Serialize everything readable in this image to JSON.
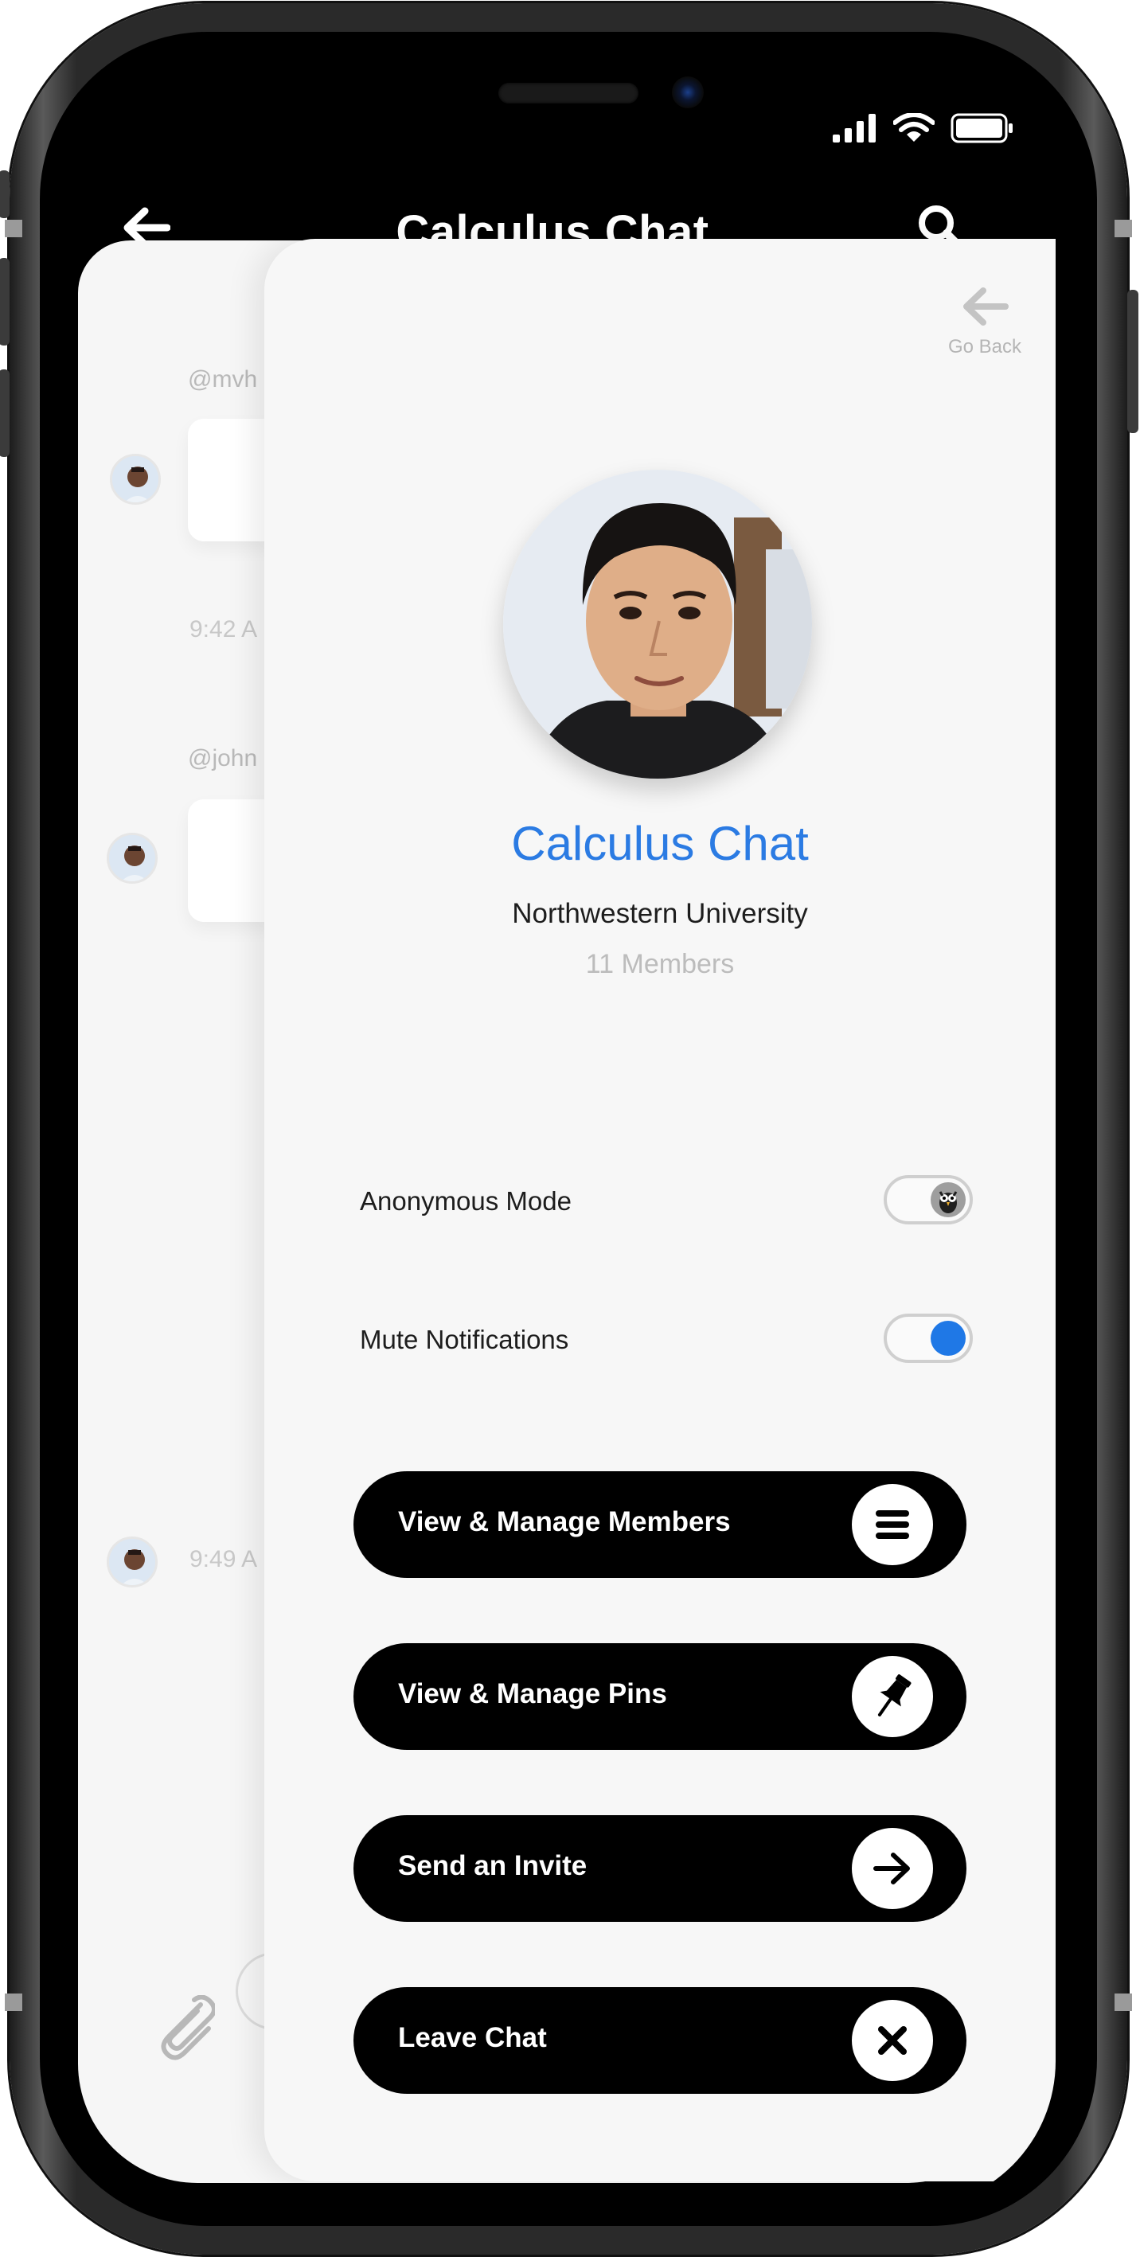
{
  "header": {
    "title": "Calculus Chat",
    "back_icon": "arrow-left-icon",
    "search_icon": "search-icon"
  },
  "status_bar": {
    "icons": [
      "signal-icon",
      "wifi-icon",
      "battery-icon"
    ]
  },
  "chat_background": {
    "messages": [
      {
        "user": "@mvh",
        "time": "9:42 A"
      },
      {
        "user": "@john",
        "time": "9:49 A"
      }
    ],
    "attach_icon": "paperclip-icon"
  },
  "info_panel": {
    "go_back_label": "Go Back",
    "group_name": "Calculus Chat",
    "school": "Northwestern University",
    "members": "11 Members",
    "settings": [
      {
        "label": "Anonymous Mode",
        "enabled": false,
        "icon": "owl-icon"
      },
      {
        "label": "Mute Notifications",
        "enabled": true
      }
    ],
    "actions": [
      {
        "label": "View & Manage Members",
        "icon": "list-icon"
      },
      {
        "label": "View & Manage Pins",
        "icon": "pin-icon"
      },
      {
        "label": "Send an Invite",
        "icon": "arrow-right-icon"
      },
      {
        "label": "Leave Chat",
        "icon": "close-icon"
      }
    ]
  },
  "colors": {
    "accent": "#2b7be3",
    "button_bg": "#000000",
    "panel_bg": "#f7f7f7"
  }
}
